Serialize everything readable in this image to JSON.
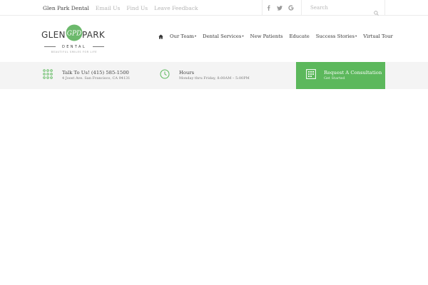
{
  "topbar": {
    "links": [
      "Glen Park Dental",
      "Email Us",
      "Find Us",
      "Leave Feedback"
    ],
    "social_icons": [
      "facebook-icon",
      "twitter-icon",
      "google-icon"
    ],
    "search_placeholder": "Search"
  },
  "logo": {
    "word_left": "GLEN",
    "word_right": "PARK",
    "monogram": "GPD",
    "subtitle": "DENTAL",
    "tagline": "BEAUTIFUL SMILES FOR LIFE"
  },
  "nav": {
    "home_icon": "home-icon",
    "items": [
      {
        "label": "Our Team",
        "dropdown": true
      },
      {
        "label": "Dental Services",
        "dropdown": true
      },
      {
        "label": "New Patients",
        "dropdown": false
      },
      {
        "label": "Educate",
        "dropdown": false
      },
      {
        "label": "Success Stories",
        "dropdown": true
      },
      {
        "label": "Virtual Tour",
        "dropdown": false
      }
    ]
  },
  "info": {
    "contact": {
      "title": "Talk To Us! (415) 585-1500",
      "detail": "4 Joost Ave. San Francisco, CA 94131",
      "icon": "dial-pad-icon"
    },
    "hours": {
      "title": "Hours",
      "detail": "Monday thru Friday, 8:00AM – 5:00PM",
      "icon": "clock-icon"
    },
    "cta": {
      "title": "Request A Consultation",
      "detail": "Get Started",
      "icon": "calendar-icon"
    }
  },
  "colors": {
    "accent": "#5cb85c",
    "infobar_bg": "#f4f4f4",
    "muted_link": "#b5b5b5"
  }
}
